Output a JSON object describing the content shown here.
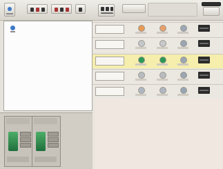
{
  "toolbar": {
    "buttons": [
      {
        "icon": "speaker-icon"
      },
      {
        "icon": "slot-strip-icon"
      },
      {
        "icon": "slot-strip-icon"
      },
      {
        "icon": "module-bank-icon"
      }
    ],
    "action_label": "",
    "exit_label": ""
  },
  "rows": [
    {
      "label": "",
      "leds": [
        "#e89a54",
        "#e6a06a",
        "#9ca8b5"
      ]
    },
    {
      "label": "",
      "leds": [
        "#c4c8cb",
        "#c7c9cb",
        "#9aa6b2"
      ]
    },
    {
      "label": "",
      "leds": [
        "#2a9a58",
        "#2b9955",
        "#9aa6b2"
      ]
    },
    {
      "label": "",
      "leds": [
        "#b8bcc0",
        "#b8bcc0",
        "#9aa6b2"
      ]
    },
    {
      "label": "",
      "leds": [
        "#aeb7c1",
        "#aeb7c1",
        "#97a5b3"
      ]
    }
  ],
  "left_panel": {
    "devices": [
      {
        "icon": "module-icon"
      },
      {
        "icon": "module-icon"
      }
    ]
  },
  "colors": {
    "highlight_row": "#f5eeac",
    "status_area": "#f1e7e1"
  }
}
